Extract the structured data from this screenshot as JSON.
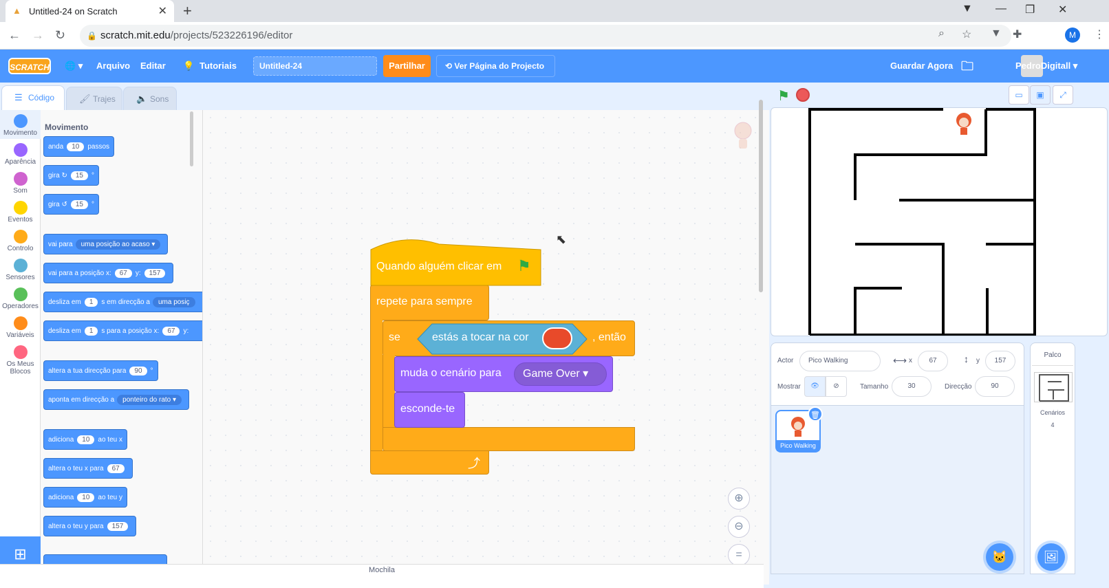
{
  "browser": {
    "tab_title": "Untitled-24 on Scratch",
    "url_host": "scratch.mit.edu",
    "url_path": "/projects/523226196/editor",
    "profile_initial": "M"
  },
  "menu": {
    "logo": "SCRATCH",
    "file": "Arquivo",
    "edit": "Editar",
    "tutorials": "Tutoriais",
    "project_title": "Untitled-24",
    "share": "Partilhar",
    "see_project": "Ver Página do Projecto",
    "save_now": "Guardar Agora",
    "username": "PedroDigitall"
  },
  "editor_tabs": {
    "code": "Código",
    "costumes": "Trajes",
    "sounds": "Sons"
  },
  "categories": [
    {
      "label": "Movimento",
      "color": "#4c97ff"
    },
    {
      "label": "Aparência",
      "color": "#9966ff"
    },
    {
      "label": "Som",
      "color": "#cf63cf"
    },
    {
      "label": "Eventos",
      "color": "#ffd500"
    },
    {
      "label": "Controlo",
      "color": "#ffab19"
    },
    {
      "label": "Sensores",
      "color": "#5cb1d6"
    },
    {
      "label": "Operadores",
      "color": "#59c059"
    },
    {
      "label": "Variáveis",
      "color": "#ff8c1a"
    },
    {
      "label": "Os Meus Blocos",
      "color": "#ff6680"
    }
  ],
  "palette": {
    "heading": "Movimento",
    "move": {
      "a": "anda",
      "v": "10",
      "b": "passos"
    },
    "turn_right": {
      "a": "gira",
      "v": "15",
      "b": "°"
    },
    "turn_left": {
      "a": "gira",
      "v": "15",
      "b": "°"
    },
    "goto": {
      "a": "vai para",
      "dd": "uma posição ao acaso"
    },
    "goto_xy": {
      "a": "vai para a posição x:",
      "x": "67",
      "ylab": "y:",
      "y": "157"
    },
    "glide": {
      "a": "desliza em",
      "v": "1",
      "b": "s em direcção a",
      "dd": "uma posiç"
    },
    "glide_xy": {
      "a": "desliza em",
      "v": "1",
      "b": "s para a posição x:",
      "x": "67",
      "ylab": "y:"
    },
    "point_dir": {
      "a": "altera a tua direcção para",
      "v": "90",
      "b": "°"
    },
    "point_towards": {
      "a": "aponta em direcção a",
      "dd": "ponteiro do rato"
    },
    "change_x": {
      "a": "adiciona",
      "v": "10",
      "b": "ao teu x"
    },
    "set_x": {
      "a": "altera o teu x para",
      "v": "67"
    },
    "change_y": {
      "a": "adiciona",
      "v": "10",
      "b": "ao teu y"
    },
    "set_y": {
      "a": "altera o teu y para",
      "v": "157"
    }
  },
  "script": {
    "hat": "Quando alguém clicar em",
    "forever": "repete para sempre",
    "if_label": "se",
    "touching": "estás a tocar na cor",
    "then": ", então",
    "switch_backdrop": "muda o cenário para",
    "backdrop_value": "Game Over",
    "hide": "esconde-te",
    "touch_color": "#e84a2a"
  },
  "sprite_info": {
    "actor_label": "Actor",
    "actor_name": "Pico Walking",
    "x_label": "x",
    "x": "67",
    "y_label": "y",
    "y": "157",
    "show_label": "Mostrar",
    "size_label": "Tamanho",
    "size": "30",
    "direction_label": "Direcção",
    "direction": "90"
  },
  "sprite_list": [
    {
      "name": "Pico Walking"
    }
  ],
  "stage_panel": {
    "title": "Palco",
    "backdrops_label": "Cenários",
    "backdrops_count": "4"
  },
  "backpack": "Mochila",
  "colors": {
    "menu_blue": "#4c97ff",
    "motion": "#4c97ff",
    "control": "#ffab19",
    "looks": "#9966ff",
    "events": "#ffbf00",
    "sensing": "#5cb1d6"
  }
}
